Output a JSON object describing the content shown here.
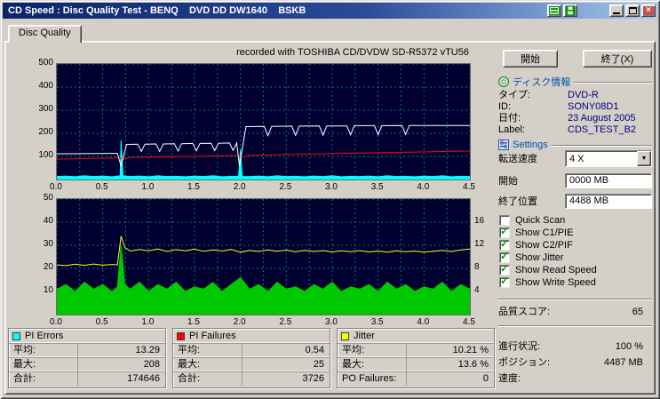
{
  "window": {
    "title": "CD Speed : Disc Quality Test - BENQ    DVD DD DW1640    BSKB"
  },
  "tab": {
    "label": "Disc Quality"
  },
  "recorded_with": "recorded with TOSHIBA CD/DVDW SD-R5372 vTU56",
  "buttons": {
    "start": "開始",
    "exit": "終了(X)"
  },
  "disc_info": {
    "header": "ディスク情報",
    "rows": [
      {
        "label": "タイプ:",
        "value": "DVD-R"
      },
      {
        "label": "ID:",
        "value": "SONY08D1"
      },
      {
        "label": "日付:",
        "value": "23 August 2005"
      },
      {
        "label": "Label:",
        "value": "CDS_TEST_B2"
      }
    ]
  },
  "settings": {
    "header": "Settings",
    "transfer_speed_label": "転送速度",
    "transfer_speed_value": "4 X",
    "start_label": "開始",
    "start_value": "0000 MB",
    "end_label": "終了位置",
    "end_value": "4488 MB",
    "checkboxes": [
      {
        "label": "Quick Scan",
        "checked": false
      },
      {
        "label": "Show C1/PIE",
        "checked": true
      },
      {
        "label": "Show C2/PIF",
        "checked": true
      },
      {
        "label": "Show Jitter",
        "checked": true
      },
      {
        "label": "Show Read Speed",
        "checked": true
      },
      {
        "label": "Show Write Speed",
        "checked": true
      }
    ]
  },
  "quality_score": {
    "label": "品質スコア:",
    "value": "65"
  },
  "progress": [
    {
      "label": "進行状況:",
      "value": "100 %"
    },
    {
      "label": "ポジション:",
      "value": "4487 MB"
    },
    {
      "label": "速度:",
      "value": ""
    }
  ],
  "stats_boxes": [
    {
      "title": "PI Errors",
      "swatch": "#00ffff",
      "rows": [
        {
          "label": "平均:",
          "value": "13.29"
        },
        {
          "label": "最大:",
          "value": "208"
        },
        {
          "label": "合計:",
          "value": "174646"
        }
      ]
    },
    {
      "title": "PI Failures",
      "swatch": "#ff0000",
      "rows": [
        {
          "label": "平均:",
          "value": "0.54"
        },
        {
          "label": "最大:",
          "value": "25"
        },
        {
          "label": "合計:",
          "value": "3726"
        }
      ]
    },
    {
      "title": "Jitter",
      "swatch": "#ffff00",
      "rows": [
        {
          "label": "平均:",
          "value": "10.21 %"
        },
        {
          "label": "最大:",
          "value": "13.6 %"
        },
        {
          "label": "PO Failures:",
          "value": "0"
        }
      ]
    }
  ],
  "chart_data": [
    {
      "type": "line",
      "name": "PI Errors / Speed graph",
      "x_range": [
        0,
        4.5
      ],
      "y_range": [
        0,
        500
      ],
      "grid": {
        "x_step": 0.25,
        "y_step": 100,
        "color": "#007a7a"
      },
      "x_ticks": [
        0,
        0.5,
        1,
        1.5,
        2,
        2.5,
        3,
        3.5,
        4,
        4.5
      ],
      "x_tick_labels": [
        "0.0",
        "0.5",
        "1.0",
        "1.5",
        "2.0",
        "2.5",
        "3.0",
        "3.5",
        "4.0",
        "4.5"
      ],
      "y_ticks": [
        500,
        400,
        300,
        200,
        100
      ],
      "series": [
        {
          "name": "c1-pie-area",
          "color": "#00ffff",
          "area": true,
          "points": [
            [
              0,
              13
            ],
            [
              0.1,
              15
            ],
            [
              0.2,
              12
            ],
            [
              0.3,
              16
            ],
            [
              0.4,
              13
            ],
            [
              0.5,
              15
            ],
            [
              0.6,
              12
            ],
            [
              0.66,
              15
            ],
            [
              0.69,
              16
            ],
            [
              0.7,
              170
            ],
            [
              0.72,
              16
            ],
            [
              0.8,
              13
            ],
            [
              0.9,
              15
            ],
            [
              1,
              12
            ],
            [
              1.1,
              16
            ],
            [
              1.2,
              13
            ],
            [
              1.3,
              14
            ],
            [
              1.4,
              12
            ],
            [
              1.5,
              15
            ],
            [
              1.6,
              13
            ],
            [
              1.7,
              16
            ],
            [
              1.8,
              12
            ],
            [
              1.9,
              14
            ],
            [
              1.98,
              14
            ],
            [
              2,
              130
            ],
            [
              2.02,
              13
            ],
            [
              2.1,
              13
            ],
            [
              2.2,
              15
            ],
            [
              2.3,
              12
            ],
            [
              2.4,
              16
            ],
            [
              2.5,
              13
            ],
            [
              2.6,
              14
            ],
            [
              2.7,
              12
            ],
            [
              2.8,
              15
            ],
            [
              2.9,
              13
            ],
            [
              3,
              16
            ],
            [
              3.1,
              12
            ],
            [
              3.2,
              14
            ],
            [
              3.3,
              13
            ],
            [
              3.4,
              15
            ],
            [
              3.5,
              12
            ],
            [
              3.6,
              16
            ],
            [
              3.7,
              13
            ],
            [
              3.8,
              14
            ],
            [
              3.9,
              12
            ],
            [
              4,
              15
            ],
            [
              4.1,
              13
            ],
            [
              4.2,
              16
            ],
            [
              4.3,
              12
            ],
            [
              4.4,
              14
            ],
            [
              4.5,
              13
            ]
          ]
        },
        {
          "name": "write-speed-line",
          "color": "#ff0000",
          "points": [
            [
              0,
              88
            ],
            [
              0.2,
              90
            ],
            [
              0.4,
              92
            ],
            [
              0.6,
              93
            ],
            [
              0.68,
              94
            ],
            [
              0.72,
              86
            ],
            [
              0.8,
              95
            ],
            [
              1,
              97
            ],
            [
              1.2,
              98
            ],
            [
              1.4,
              100
            ],
            [
              1.6,
              101
            ],
            [
              1.8,
              103
            ],
            [
              1.96,
              104
            ],
            [
              2.02,
              96
            ],
            [
              2.1,
              105
            ],
            [
              2.3,
              107
            ],
            [
              2.5,
              108
            ],
            [
              2.7,
              110
            ],
            [
              2.9,
              111
            ],
            [
              3.1,
              113
            ],
            [
              3.3,
              114
            ],
            [
              3.5,
              116
            ],
            [
              3.7,
              117
            ],
            [
              3.9,
              119
            ],
            [
              4.1,
              120
            ],
            [
              4.3,
              122
            ],
            [
              4.5,
              123
            ]
          ]
        },
        {
          "name": "read-speed-line",
          "color": "#ffffff",
          "points": [
            [
              0,
              111
            ],
            [
              0.3,
              112
            ],
            [
              0.66,
              113
            ],
            [
              0.7,
              58
            ],
            [
              0.76,
              152
            ],
            [
              0.88,
              153
            ],
            [
              0.92,
              121
            ],
            [
              0.96,
              153
            ],
            [
              1.08,
              154
            ],
            [
              1.12,
              122
            ],
            [
              1.16,
              154
            ],
            [
              1.28,
              155
            ],
            [
              1.32,
              123
            ],
            [
              1.36,
              155
            ],
            [
              1.48,
              156
            ],
            [
              1.52,
              124
            ],
            [
              1.56,
              156
            ],
            [
              1.68,
              157
            ],
            [
              1.72,
              125
            ],
            [
              1.76,
              157
            ],
            [
              1.88,
              158
            ],
            [
              1.92,
              126
            ],
            [
              1.96,
              158
            ],
            [
              1.99,
              58
            ],
            [
              2.06,
              229
            ],
            [
              2.26,
              230
            ],
            [
              2.3,
              190
            ],
            [
              2.34,
              230
            ],
            [
              2.56,
              231
            ],
            [
              2.6,
              191
            ],
            [
              2.64,
              231
            ],
            [
              2.86,
              232
            ],
            [
              2.9,
              192
            ],
            [
              2.94,
              232
            ],
            [
              3.16,
              232
            ],
            [
              3.2,
              193
            ],
            [
              3.24,
              233
            ],
            [
              3.46,
              233
            ],
            [
              3.5,
              194
            ],
            [
              3.54,
              233
            ],
            [
              3.76,
              234
            ],
            [
              3.8,
              195
            ],
            [
              3.84,
              234
            ],
            [
              4.5,
              234
            ]
          ]
        }
      ]
    },
    {
      "type": "line",
      "name": "Jitter / PI Failures graph",
      "x_range": [
        0,
        4.5
      ],
      "y_range": [
        0,
        50
      ],
      "grid": {
        "x_step": 0.25,
        "y_step": 10,
        "color": "#007a7a"
      },
      "x_ticks": [
        0,
        0.5,
        1,
        1.5,
        2,
        2.5,
        3,
        3.5,
        4,
        4.5
      ],
      "x_tick_labels": [
        "0.0",
        "0.5",
        "1.0",
        "1.5",
        "2.0",
        "2.5",
        "3.0",
        "3.5",
        "4.0",
        "4.5"
      ],
      "y_ticks_left": [
        50,
        40,
        30,
        20,
        10
      ],
      "y_ticks_right": [
        {
          "label": "16",
          "at": 40
        },
        {
          "label": "12",
          "at": 30
        },
        {
          "label": "8",
          "at": 20
        },
        {
          "label": "4",
          "at": 10
        }
      ],
      "series": [
        {
          "name": "pi-failures-area",
          "color": "#00c800",
          "area": true,
          "points": [
            [
              0,
              11
            ],
            [
              0.1,
              13
            ],
            [
              0.2,
              10
            ],
            [
              0.3,
              14
            ],
            [
              0.4,
              11
            ],
            [
              0.5,
              13
            ],
            [
              0.6,
              10
            ],
            [
              0.66,
              12
            ],
            [
              0.7,
              30
            ],
            [
              0.74,
              13
            ],
            [
              0.8,
              11
            ],
            [
              0.9,
              14
            ],
            [
              1,
              10
            ],
            [
              1.1,
              13
            ],
            [
              1.2,
              11
            ],
            [
              1.3,
              14
            ],
            [
              1.4,
              10
            ],
            [
              1.5,
              12
            ],
            [
              1.6,
              11
            ],
            [
              1.7,
              14
            ],
            [
              1.8,
              10
            ],
            [
              1.9,
              13
            ],
            [
              2,
              16
            ],
            [
              2.1,
              11
            ],
            [
              2.2,
              13
            ],
            [
              2.3,
              10
            ],
            [
              2.4,
              14
            ],
            [
              2.5,
              11
            ],
            [
              2.6,
              12
            ],
            [
              2.7,
              10
            ],
            [
              2.8,
              13
            ],
            [
              2.9,
              11
            ],
            [
              3,
              14
            ],
            [
              3.1,
              10
            ],
            [
              3.2,
              12
            ],
            [
              3.3,
              11
            ],
            [
              3.4,
              13
            ],
            [
              3.5,
              10
            ],
            [
              3.6,
              14
            ],
            [
              3.7,
              11
            ],
            [
              3.8,
              13
            ],
            [
              3.9,
              10
            ],
            [
              4,
              12
            ],
            [
              4.1,
              11
            ],
            [
              4.2,
              14
            ],
            [
              4.3,
              10
            ],
            [
              4.4,
              13
            ],
            [
              4.5,
              11
            ]
          ]
        },
        {
          "name": "jitter-line",
          "color": "#ffff00",
          "points": [
            [
              0,
              21.5
            ],
            [
              0.1,
              21.2
            ],
            [
              0.2,
              21.8
            ],
            [
              0.3,
              21.3
            ],
            [
              0.4,
              21.9
            ],
            [
              0.5,
              21.4
            ],
            [
              0.6,
              21.7
            ],
            [
              0.66,
              21.5
            ],
            [
              0.7,
              34
            ],
            [
              0.74,
              29
            ],
            [
              0.8,
              27.5
            ],
            [
              0.9,
              28.2
            ],
            [
              1,
              27.6
            ],
            [
              1.1,
              28.4
            ],
            [
              1.2,
              27.3
            ],
            [
              1.3,
              28.1
            ],
            [
              1.4,
              27.6
            ],
            [
              1.5,
              28.3
            ],
            [
              1.6,
              27.4
            ],
            [
              1.7,
              28
            ],
            [
              1.8,
              27.5
            ],
            [
              1.9,
              28.2
            ],
            [
              2,
              27
            ],
            [
              2.1,
              27.8
            ],
            [
              2.2,
              27.3
            ],
            [
              2.3,
              28
            ],
            [
              2.4,
              27.4
            ],
            [
              2.5,
              27.9
            ],
            [
              2.6,
              27.2
            ],
            [
              2.7,
              27.8
            ],
            [
              2.8,
              27.3
            ],
            [
              2.9,
              27.7
            ],
            [
              3,
              27.1
            ],
            [
              3.1,
              27.6
            ],
            [
              3.2,
              27.2
            ],
            [
              3.3,
              27.7
            ],
            [
              3.4,
              27.1
            ],
            [
              3.5,
              27.5
            ],
            [
              3.6,
              27
            ],
            [
              3.7,
              27.6
            ],
            [
              3.8,
              27.2
            ],
            [
              3.9,
              27.5
            ],
            [
              4,
              27
            ],
            [
              4.1,
              27.4
            ],
            [
              4.2,
              27.8
            ],
            [
              4.3,
              27.3
            ],
            [
              4.4,
              28
            ],
            [
              4.5,
              28.4
            ]
          ]
        }
      ]
    }
  ]
}
